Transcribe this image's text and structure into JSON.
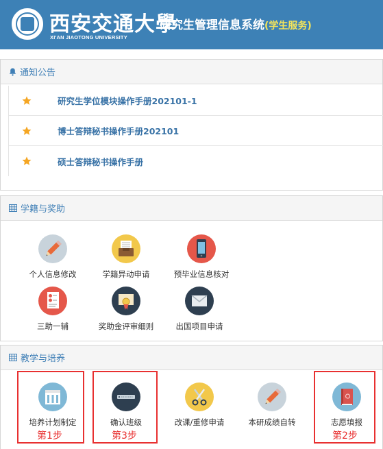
{
  "header": {
    "logo_cn": "西安交通大學",
    "logo_en": "XI'AN JIAOTONG UNIVERSITY",
    "title": "研究生管理信息系统",
    "subtitle": "(学生服务)"
  },
  "notices": {
    "title": "通知公告",
    "icon": "bell-icon",
    "items": [
      {
        "label": "研究生学位模块操作手册202101-1"
      },
      {
        "label": "博士答辩秘书操作手册202101"
      },
      {
        "label": "硕士答辩秘书操作手册"
      }
    ]
  },
  "enrollment": {
    "title": "学籍与奖助",
    "icon": "grid-icon",
    "items": [
      {
        "label": "个人信息修改",
        "icon": "pencil-icon",
        "color": "#c8d3db"
      },
      {
        "label": "学籍异动申请",
        "icon": "inbox-icon",
        "color": "#f2c84b"
      },
      {
        "label": "预毕业信息核对",
        "icon": "phone-icon",
        "color": "#e5574a"
      },
      {
        "label": "三助一辅",
        "icon": "document-icon",
        "color": "#e5574a"
      },
      {
        "label": "奖助金评审细则",
        "icon": "certificate-icon",
        "color": "#2e3f50"
      },
      {
        "label": "出国项目申请",
        "icon": "envelope-icon",
        "color": "#2e3f50"
      }
    ]
  },
  "teaching": {
    "title": "教学与培养",
    "icon": "grid-icon",
    "items": [
      {
        "label": "培养计划制定",
        "icon": "building-icon",
        "color": "#7fb8d6",
        "step": "第1步"
      },
      {
        "label": "确认班级",
        "icon": "server-icon",
        "color": "#2e3f50",
        "step": "第3步"
      },
      {
        "label": "改课/重修申请",
        "icon": "scissors-icon",
        "color": "#f2c84b",
        "step": ""
      },
      {
        "label": "本研成绩自转",
        "icon": "pencil-icon",
        "color": "#c8d3db",
        "step": ""
      },
      {
        "label": "志愿填报",
        "icon": "book-icon",
        "color": "#7fb8d6",
        "step": "第2步"
      }
    ]
  },
  "colors": {
    "header_bg": "#3d81b6",
    "link": "#3872a6",
    "highlight": "#e83030"
  }
}
